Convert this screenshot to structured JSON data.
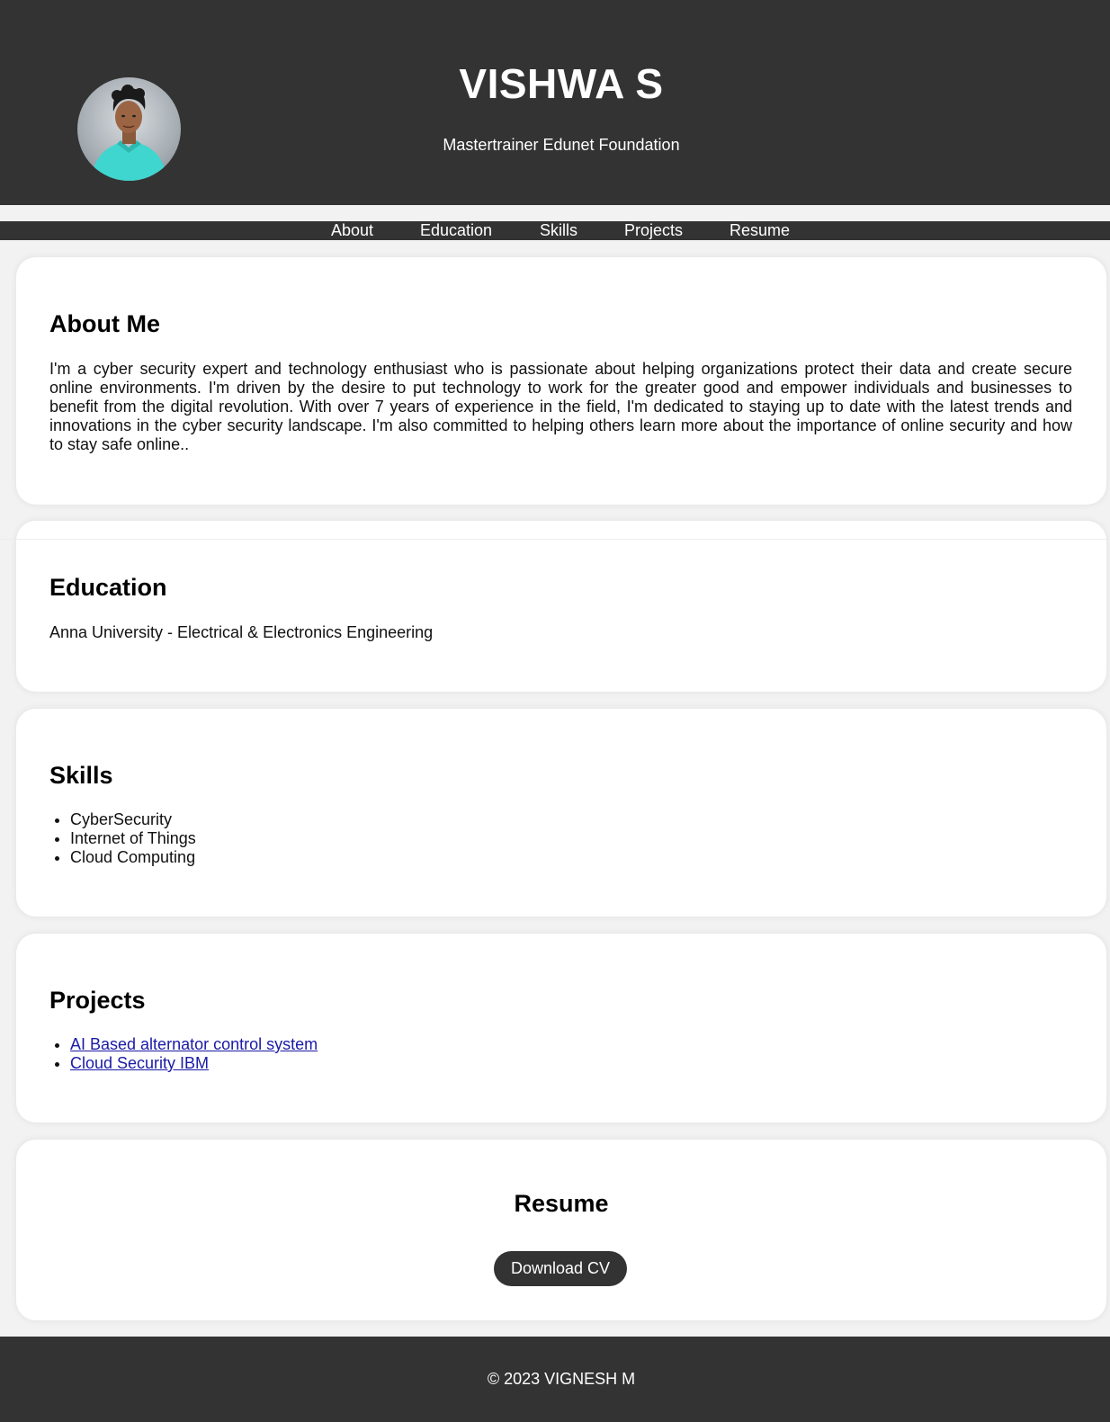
{
  "header": {
    "name": "VISHWA S",
    "subtitle": "Mastertrainer Edunet Foundation",
    "avatar_icon": "profile-photo"
  },
  "nav": {
    "items": [
      {
        "label": "About"
      },
      {
        "label": "Education"
      },
      {
        "label": "Skills"
      },
      {
        "label": "Projects"
      },
      {
        "label": "Resume"
      }
    ]
  },
  "about": {
    "title": "About Me",
    "text": "I'm a cyber security expert and technology enthusiast who is passionate about helping organizations protect their data and create secure online environments. I'm driven by the desire to put technology to work for the greater good and empower individuals and businesses to benefit from the digital revolution. With over 7 years of experience in the field, I'm dedicated to staying up to date with the latest trends and innovations in the cyber security landscape. I'm also committed to helping others learn more about the importance of online security and how to stay safe online.."
  },
  "education": {
    "title": "Education",
    "text": "Anna University - Electrical & Electronics Engineering"
  },
  "skills": {
    "title": "Skills",
    "items": [
      "CyberSecurity",
      "Internet of Things",
      "Cloud Computing"
    ]
  },
  "projects": {
    "title": "Projects",
    "items": [
      "AI Based alternator control system",
      "Cloud Security IBM"
    ]
  },
  "resume": {
    "title": "Resume",
    "button_label": "Download CV"
  },
  "footer": {
    "text": "© 2023 VIGNESH M"
  },
  "colors": {
    "dark": "#333333",
    "page_bg": "#f2f2f2",
    "card_bg": "#ffffff",
    "link": "#1a1aa6"
  }
}
